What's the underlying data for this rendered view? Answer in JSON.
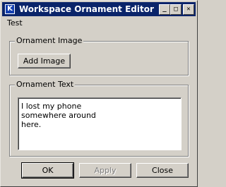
{
  "window": {
    "title": "Workspace Ornament Editor",
    "icon": "k-app-icon",
    "controls": {
      "minimize": "_",
      "maximize": "□",
      "close": "✕"
    }
  },
  "menubar": {
    "items": [
      "Test"
    ]
  },
  "image_group": {
    "legend": "Ornament Image",
    "add_image_label": "Add Image"
  },
  "text_group": {
    "legend": "Ornament Text",
    "text": "I lost my phone\nsomewhere around\nhere."
  },
  "footer": {
    "ok_label": "OK",
    "apply_label": "Apply",
    "close_label": "Close"
  }
}
